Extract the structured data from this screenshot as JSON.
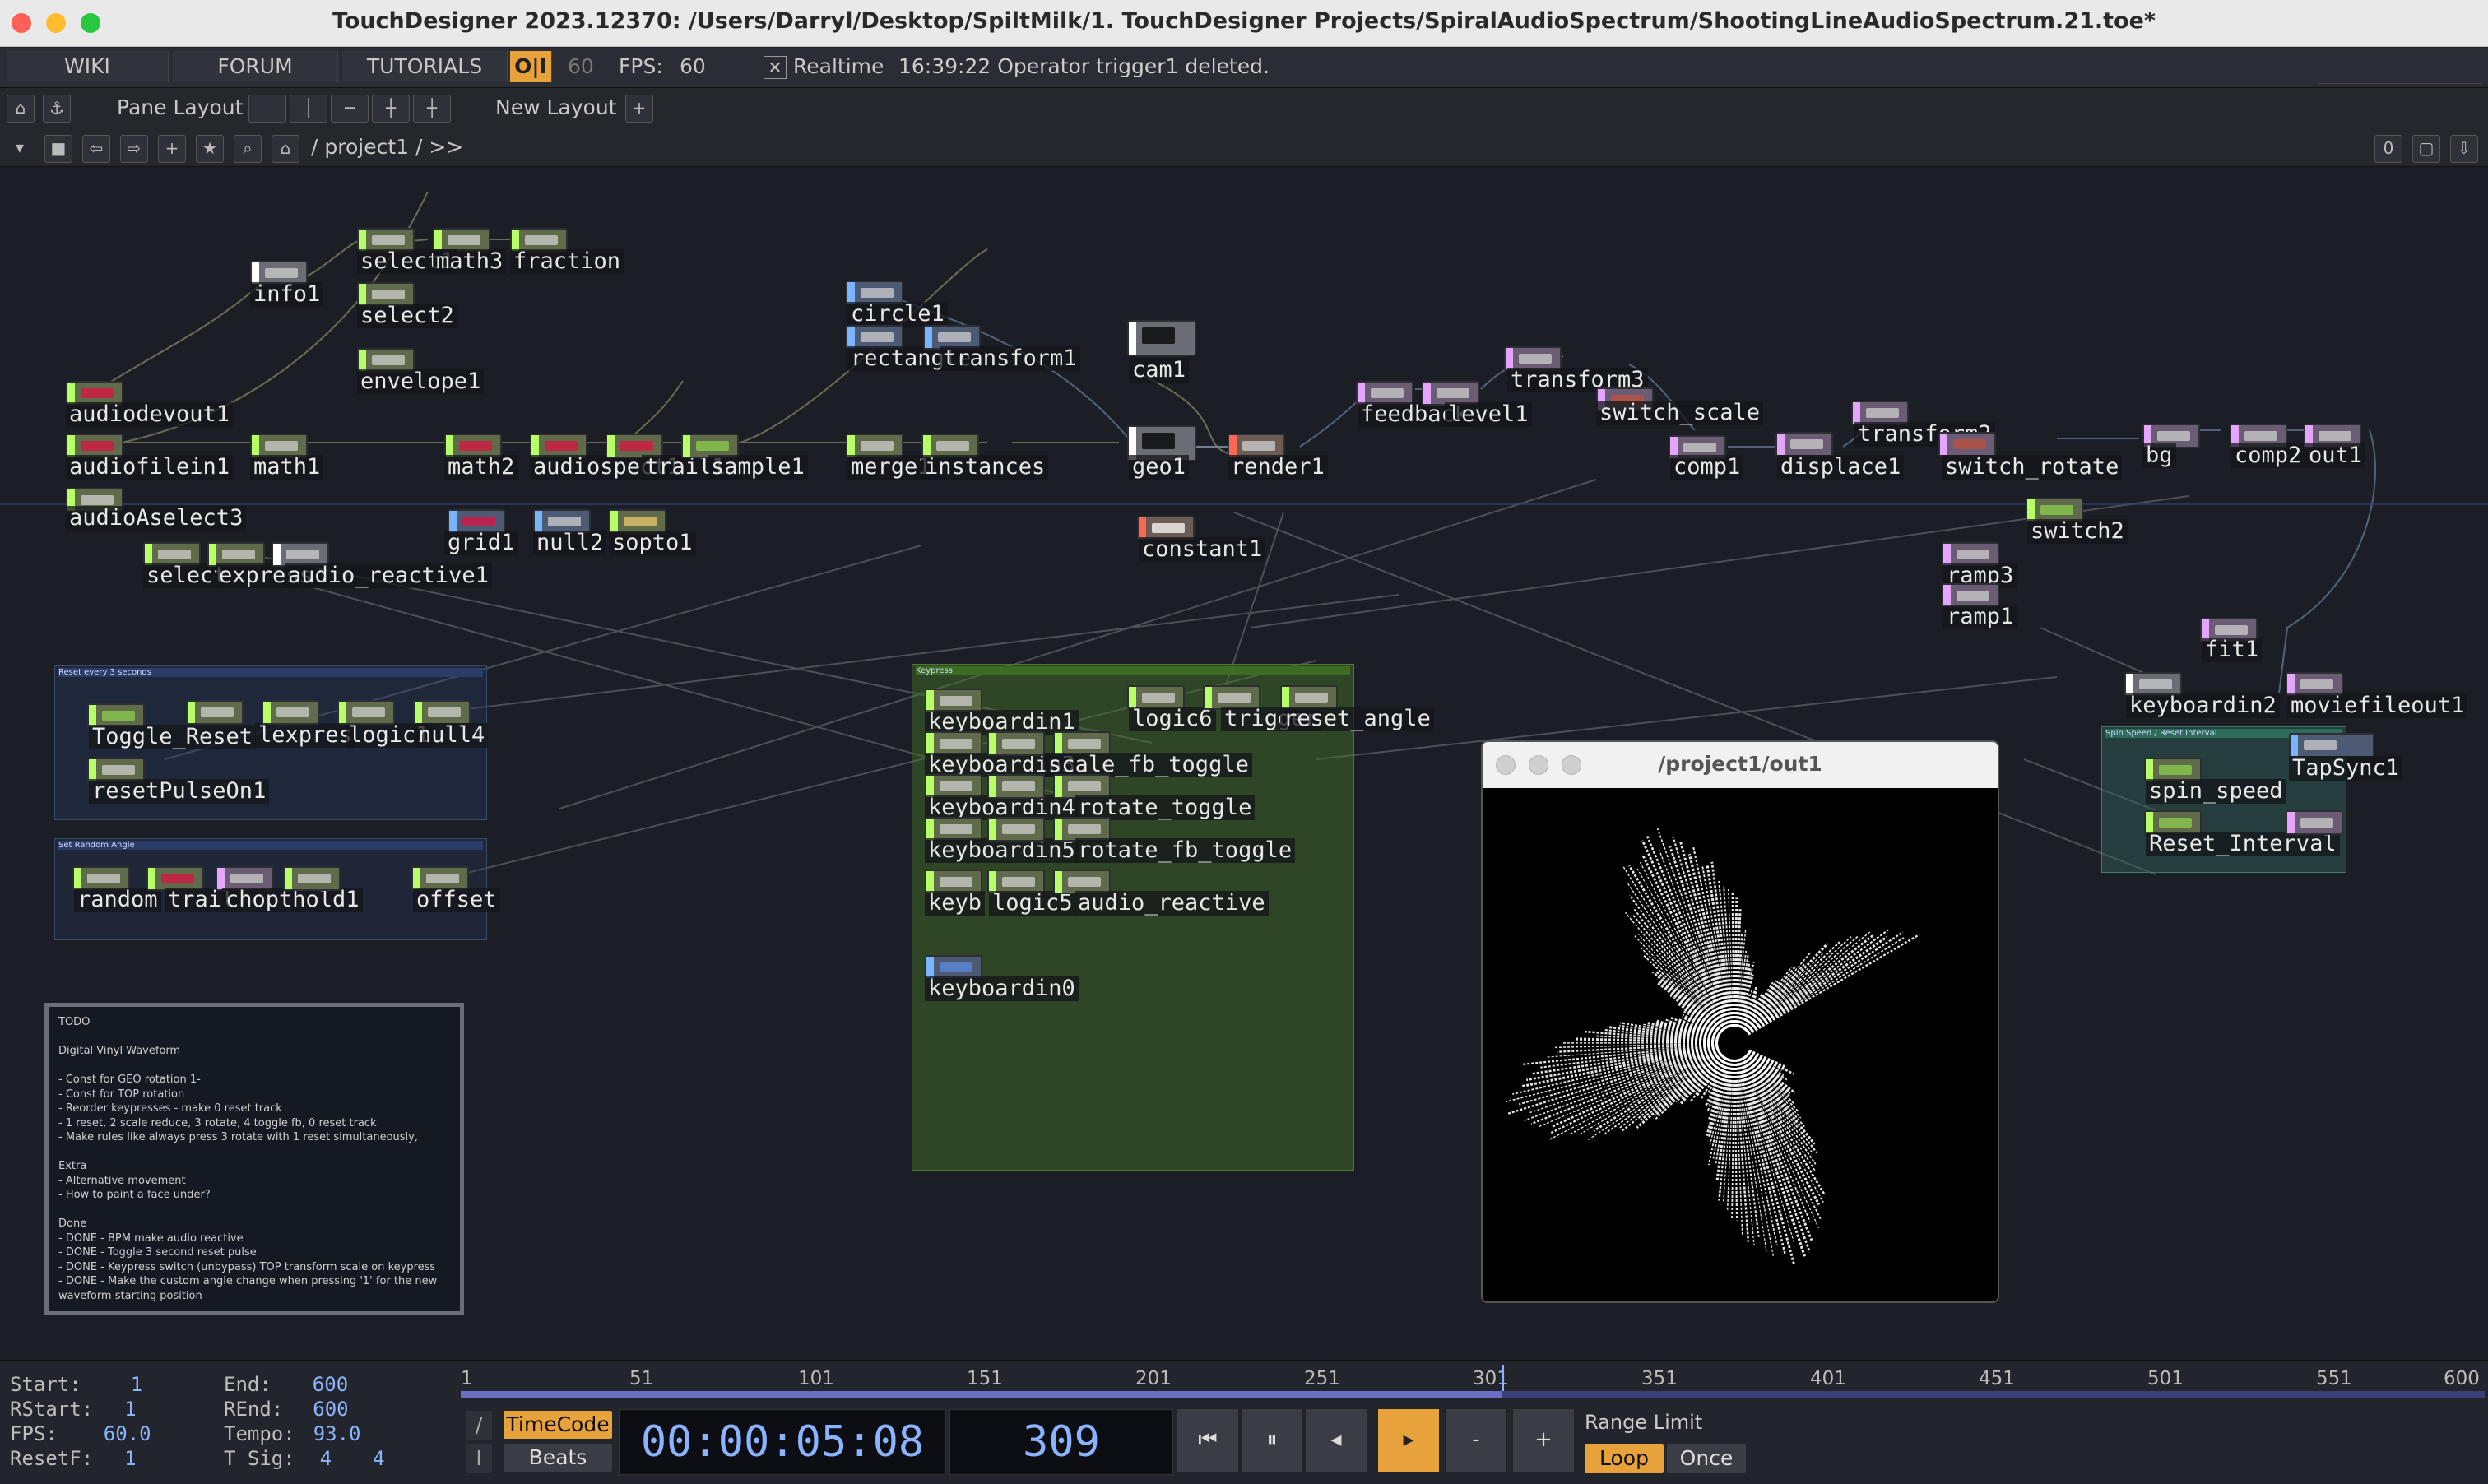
{
  "window": {
    "title": "TouchDesigner 2023.12370: /Users/Darryl/Desktop/SpiltMilk/1. TouchDesigner Projects/SpiralAudioSpectrum/ShootingLineAudioSpectrum.21.toe*"
  },
  "menubar": {
    "wiki": "WIKI",
    "forum": "FORUM",
    "tutorials": "TUTORIALS",
    "oi": "O|I",
    "fps_cap": "60",
    "fps_label": "FPS:",
    "fps_value": "60",
    "realtime_check": "✕",
    "realtime": "Realtime",
    "status": "16:39:22 Operator trigger1 deleted."
  },
  "toolbar": {
    "pane_layout": "Pane Layout",
    "new_layout": "New Layout",
    "add": "+"
  },
  "pathbar": {
    "path": "/ project1 / >>",
    "right_value": "0"
  },
  "nodes": [
    {
      "name": "select1",
      "label": "select1"
    },
    {
      "name": "math3",
      "label": "math3"
    },
    {
      "name": "fraction",
      "label": "fraction"
    },
    {
      "name": "info1",
      "label": "info1"
    },
    {
      "name": "select2",
      "label": "select2"
    },
    {
      "name": "envelope1",
      "label": "envelope1"
    },
    {
      "name": "audiodevout1",
      "label": "audiodevout1"
    },
    {
      "name": "audiofilein1",
      "label": "audiofilein1"
    },
    {
      "name": "math1",
      "label": "math1"
    },
    {
      "name": "math2",
      "label": "math2"
    },
    {
      "name": "audiospect1",
      "label": "audiospect1"
    },
    {
      "name": "trail1",
      "label": "trail1"
    },
    {
      "name": "sample1",
      "label": "sample1"
    },
    {
      "name": "audioAselect3",
      "label": "audioAselect3"
    },
    {
      "name": "grid1",
      "label": "grid1"
    },
    {
      "name": "null2",
      "label": "null2"
    },
    {
      "name": "sopto1",
      "label": "sopto1"
    },
    {
      "name": "select",
      "label": "select"
    },
    {
      "name": "express",
      "label": "express"
    },
    {
      "name": "audio_reactive1",
      "label": "audio_reactive1"
    },
    {
      "name": "circle1",
      "label": "circle1"
    },
    {
      "name": "rectangle",
      "label": "rectangle"
    },
    {
      "name": "transform1",
      "label": "transform1"
    },
    {
      "name": "merge1",
      "label": "merge1"
    },
    {
      "name": "instances",
      "label": "instances"
    },
    {
      "name": "cam1",
      "label": "cam1"
    },
    {
      "name": "geo1",
      "label": "geo1"
    },
    {
      "name": "render1",
      "label": "render1"
    },
    {
      "name": "constant1",
      "label": "constant1"
    },
    {
      "name": "feedback",
      "label": "feedback"
    },
    {
      "name": "level1",
      "label": "level1"
    },
    {
      "name": "transform3",
      "label": "transform3"
    },
    {
      "name": "switch_scale",
      "label": "switch_scale"
    },
    {
      "name": "comp1",
      "label": "comp1"
    },
    {
      "name": "displace1",
      "label": "displace1"
    },
    {
      "name": "transform2",
      "label": "transform2"
    },
    {
      "name": "switch_rotate",
      "label": "switch_rotate"
    },
    {
      "name": "bg",
      "label": "bg"
    },
    {
      "name": "comp2",
      "label": "comp2"
    },
    {
      "name": "out1",
      "label": "out1"
    },
    {
      "name": "switch2",
      "label": "switch2"
    },
    {
      "name": "ramp3",
      "label": "ramp3"
    },
    {
      "name": "ramp1",
      "label": "ramp1"
    },
    {
      "name": "fit1",
      "label": "fit1"
    },
    {
      "name": "keyboardin2",
      "label": "keyboardin2"
    },
    {
      "name": "moviefileout1",
      "label": "moviefileout1"
    },
    {
      "name": "tapsync1",
      "label": "TapSync1"
    },
    {
      "name": "spin_speed",
      "label": "spin_speed"
    },
    {
      "name": "reset_interval",
      "label": "Reset_Interval"
    },
    {
      "name": "toggle_reset",
      "label": "Toggle_Reset"
    },
    {
      "name": "lexpres",
      "label": "lexpres"
    },
    {
      "name": "logic1",
      "label": "logic1"
    },
    {
      "name": "null4",
      "label": "null4"
    },
    {
      "name": "resetpulseon1",
      "label": "resetPulseOn1"
    },
    {
      "name": "random",
      "label": "random"
    },
    {
      "name": "trail",
      "label": "trail"
    },
    {
      "name": "chopthold1",
      "label": "chopthold1"
    },
    {
      "name": "offset",
      "label": "offset"
    },
    {
      "name": "keyboardin1",
      "label": "keyboardin1"
    },
    {
      "name": "logic6",
      "label": "logic6"
    },
    {
      "name": "trigger",
      "label": "trigger"
    },
    {
      "name": "reset_angle",
      "label": "reset_angle"
    },
    {
      "name": "keyboardin3",
      "label": "keyboardin3"
    },
    {
      "name": "scale_fb_toggle",
      "label": "scale_fb_toggle"
    },
    {
      "name": "keyboardin4",
      "label": "keyboardin4"
    },
    {
      "name": "rotate_toggle",
      "label": "rotate_toggle"
    },
    {
      "name": "keyboardin5",
      "label": "keyboardin5"
    },
    {
      "name": "rotate_fb_toggle",
      "label": "rotate_fb_toggle"
    },
    {
      "name": "keyb",
      "label": "keyb"
    },
    {
      "name": "logic5",
      "label": "logic5"
    },
    {
      "name": "audio_reactive",
      "label": "audio_reactive"
    },
    {
      "name": "keyboardin0",
      "label": "keyboardin0"
    }
  ],
  "boxes": {
    "reset_every": "Reset every 3 seconds",
    "set_random": "Set Random Angle",
    "keypress": "Keypress",
    "spin_reset": "Spin Speed / Reset Interval"
  },
  "todo": {
    "text": "TODO\n\nDigital Vinyl Waveform\n\n- Const for GEO rotation 1-\n- Const for TOP rotation\n- Reorder keypresses - make 0 reset track\n      - 1 reset, 2 scale reduce, 3 rotate, 4 toggle fb, 0 reset track\n- Make rules like always press 3 rotate with 1 reset simultaneously,\n\nExtra\n- Alternative movement\n- How to paint a face under?\n\nDone\n- DONE - BPM make audio reactive\n- DONE - Toggle 3 second reset pulse\n- DONE - Keypress switch (unbypass) TOP transform scale on keypress\n- DONE - Make the custom angle change when pressing '1' for the new waveform starting position"
  },
  "viewer": {
    "title": "/project1/out1"
  },
  "timeline": {
    "start_label": "Start:",
    "start": "1",
    "end_label": "End:",
    "end": "600",
    "rstart_label": "RStart:",
    "rstart": "1",
    "rend_label": "REnd:",
    "rend": "600",
    "fps_label": "FPS:",
    "fps": "60.0",
    "tempo_label": "Tempo:",
    "tempo": "93.0",
    "resetf_label": "ResetF:",
    "resetf": "1",
    "tsig_label": "T Sig:",
    "tsig_a": "4",
    "tsig_b": "4",
    "ticks": [
      "1",
      "51",
      "101",
      "151",
      "201",
      "251",
      "301",
      "351",
      "401",
      "451",
      "501",
      "551",
      "600"
    ],
    "current_frame": 309,
    "timecode_btn": "TimeCode",
    "beats_btn": "Beats",
    "slash": "/",
    "io": "I",
    "timecode": "00:00:05:08",
    "frame": "309",
    "range_limit": "Range Limit",
    "loop": "Loop",
    "once": "Once",
    "btn_minus": "-",
    "btn_plus": "+"
  },
  "colors": {
    "accent": "#e8a23c",
    "chop": "#8ccf4f",
    "top": "#c2503e",
    "sop": "#5d8be2",
    "timecode": "#8ab4ff"
  }
}
